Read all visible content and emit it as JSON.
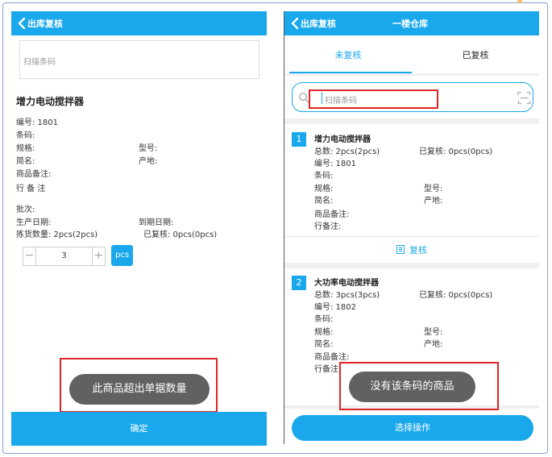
{
  "left": {
    "header": {
      "back_label": "出库复核"
    },
    "scan_placeholder": "扫描条码",
    "product": {
      "name": "增力电动搅拌器",
      "code": "编号: 1801",
      "barcode": "条码:",
      "spec": "规格:",
      "model": "型号:",
      "short_name": "简名:",
      "origin": "产地:",
      "remark": "商品备注:",
      "line_remark": "行 备 注",
      "batch": "批次:",
      "prod_date": "生产日期:",
      "exp_date": "到期日期:",
      "pick_qty": "拣货数量: 2pcs(2pcs)",
      "reviewed": "已复核: 0pcs(0pcs)"
    },
    "stepper": {
      "minus": "−",
      "value": "3",
      "plus": "+"
    },
    "unit_button": "pcs",
    "toast": "此商品超出单据数量",
    "confirm_button": "确定"
  },
  "right": {
    "header": {
      "back_label": "出库复核",
      "title": "一楼仓库"
    },
    "tabs": [
      {
        "label": "未复核",
        "active": true
      },
      {
        "label": "已复核",
        "active": false
      }
    ],
    "search_placeholder": "扫描条码",
    "items": [
      {
        "index": "1",
        "name": "增力电动搅拌器",
        "total": "总数: 2pcs(2pcs)",
        "reviewed": "已复核: 0pcs(0pcs)",
        "code": "编号: 1801",
        "barcode": "条码:",
        "spec": "规格:",
        "model": "型号:",
        "short_name": "简名:",
        "origin": "产地:",
        "remark": "商品备注:",
        "line_remark": "行备注:"
      },
      {
        "index": "2",
        "name": "大功率电动搅拌器",
        "total": "总数: 3pcs(3pcs)",
        "reviewed": "已复核: 0pcs(0pcs)",
        "code": "编号: 1802",
        "barcode": "条码:",
        "spec": "规格:",
        "model": "型号:",
        "short_name": "简名:",
        "origin": "产地:",
        "remark": "商品备注:",
        "line_remark": "行备注:"
      }
    ],
    "review_button": "复核",
    "toast": "没有该条码的商品",
    "select_button": "选择操作"
  },
  "colors": {
    "accent": "#19a8ec",
    "toast": "#616161",
    "highlight": "#dd2525"
  },
  "icons": [
    "back-chevron-icon",
    "search-icon",
    "scan-icon",
    "review-icon"
  ]
}
